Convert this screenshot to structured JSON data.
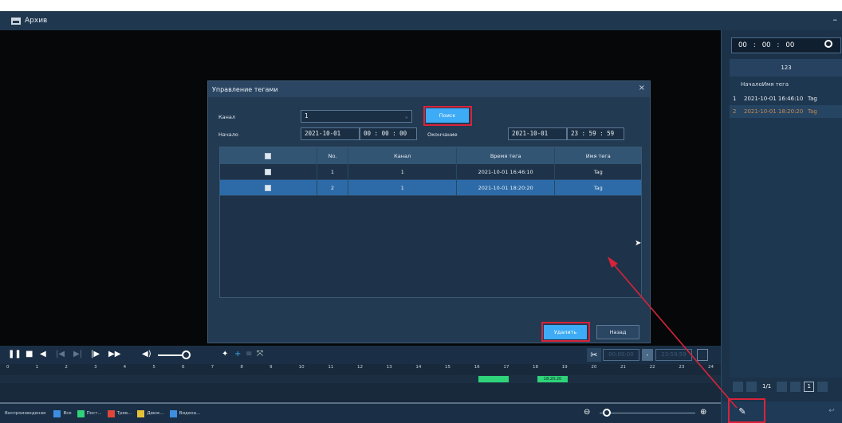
{
  "window": {
    "title": "Архив",
    "minimize": "–"
  },
  "right_panel": {
    "time": [
      "00",
      ":",
      "00",
      ":",
      "00"
    ],
    "group_label": "123",
    "headers": [
      "Начало",
      "Имя тега"
    ],
    "rows": [
      {
        "n": "1",
        "start": "2021-10-01 16:46:10",
        "tag": "Tag"
      },
      {
        "n": "2",
        "start": "2021-10-01 18:20:20",
        "tag": "Tag"
      }
    ],
    "pager": "1/1",
    "page_input": "1"
  },
  "dialog": {
    "title": "Управление тегами",
    "close": "×",
    "channel_label": "Канал",
    "channel_value": "1",
    "search_label": "Поиск",
    "start_label": "Начало",
    "start_date": "2021-10-01",
    "start_time": "00 : 00 : 00",
    "end_label": "Окончание",
    "end_date": "2021-10-01",
    "end_time": "23 : 59 : 59",
    "columns": [
      "No.",
      "Канал",
      "Время тега",
      "Имя тега"
    ],
    "rows": [
      {
        "no": "1",
        "channel": "1",
        "time": "2021-10-01 16:46:10",
        "tag": "Tag"
      },
      {
        "no": "2",
        "channel": "1",
        "time": "2021-10-01 18:20:20",
        "tag": "Tag"
      }
    ],
    "delete_label": "Удалить",
    "back_label": "Назад"
  },
  "controls": {
    "clip_start": "00:00:00",
    "clip_dash": "-",
    "clip_end": "23:59:59"
  },
  "timeline": {
    "ticks": [
      "0",
      "1",
      "2",
      "3",
      "4",
      "5",
      "6",
      "7",
      "8",
      "9",
      "10",
      "11",
      "12",
      "13",
      "14",
      "15",
      "16",
      "17",
      "18",
      "19",
      "20",
      "21",
      "22",
      "23",
      "24"
    ],
    "segment_label": "18:20:20"
  },
  "status": {
    "playback_label": "Воспроизведение",
    "legend": [
      {
        "label": "Все",
        "color": "#3d8ee0"
      },
      {
        "label": "Пост...",
        "color": "#2ed37a"
      },
      {
        "label": "Трев...",
        "color": "#e0463a"
      },
      {
        "label": "Движ...",
        "color": "#e3c23a"
      },
      {
        "label": "Видеоа...",
        "color": "#3d8ee0"
      }
    ]
  },
  "colors": {
    "accent": "#3dabf5",
    "highlight_border": "#d9233a",
    "selected_row": "#2d6ba8",
    "record_segment": "#2ed37a"
  }
}
